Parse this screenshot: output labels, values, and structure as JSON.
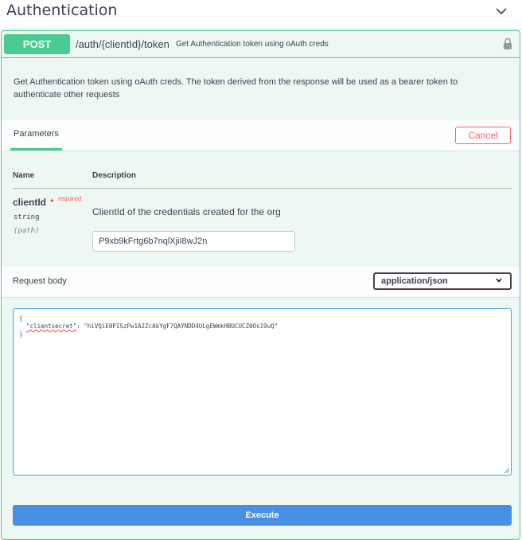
{
  "tag": {
    "title": "Authentication",
    "toggle_icon": "chevron-down-icon"
  },
  "operation": {
    "method": "POST",
    "path": "/auth/{clientId}/token",
    "summary": "Get Authentication token using oAuth creds",
    "lock_icon": "lock-icon",
    "description": "Get Authentication token using oAuth creds. The token derived from the response will be used as a bearer token to authenticate other requests",
    "colors": {
      "method": "#49cc90",
      "background": "#eef8f3",
      "cancel": "#ff6060",
      "execute": "#4990e2"
    }
  },
  "parameters": {
    "tab_label": "Parameters",
    "cancel_label": "Cancel",
    "col_name": "Name",
    "col_description": "Description",
    "items": [
      {
        "name": "clientId",
        "required_star": "*",
        "required_label": "required",
        "type": "string",
        "in": "(path)",
        "description": "ClientId of the credentials created for the org",
        "value": "P9xb9kFrtg6b7nqlXjiI8wJ2n"
      }
    ]
  },
  "request_body": {
    "label": "Request body",
    "content_type": "application/json",
    "open_brace": "{",
    "key": "\"clientsecret\"",
    "separator": ": ",
    "value": "\"hiVQiE0PISzPw1A2ZcAkYgF7QAYNDD4ULgEWmkHBUCUCZ0Os19uQ\"",
    "close_brace": "}"
  },
  "execute_label": "Execute"
}
